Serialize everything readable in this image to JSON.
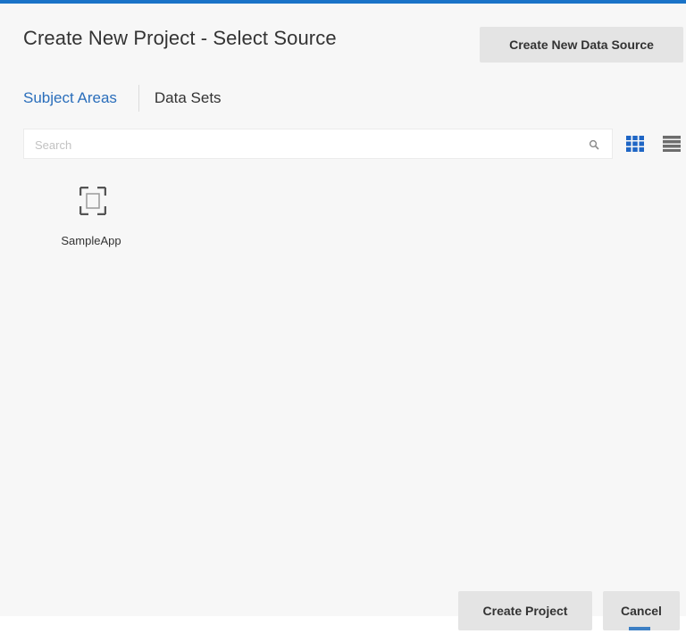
{
  "dialog": {
    "title": "Create New Project - Select Source",
    "create_data_source_label": "Create New Data Source"
  },
  "tabs": [
    {
      "label": "Subject Areas",
      "active": true
    },
    {
      "label": "Data Sets",
      "active": false
    }
  ],
  "search": {
    "value": "",
    "placeholder": "Search",
    "icon": "search-icon"
  },
  "view_toggle": {
    "selected": "grid",
    "grid_icon": "grid-view-icon",
    "list_icon": "list-view-icon"
  },
  "items": [
    {
      "label": "SampleApp",
      "icon": "subject-area-icon"
    }
  ],
  "footer": {
    "create_label": "Create Project",
    "cancel_label": "Cancel"
  },
  "colors": {
    "accent": "#2a6ebb",
    "top_bar": "#1a73c8",
    "icon_blue": "#1f66c5",
    "button_bg": "#e4e4e4",
    "dialog_bg": "#f7f7f7"
  }
}
